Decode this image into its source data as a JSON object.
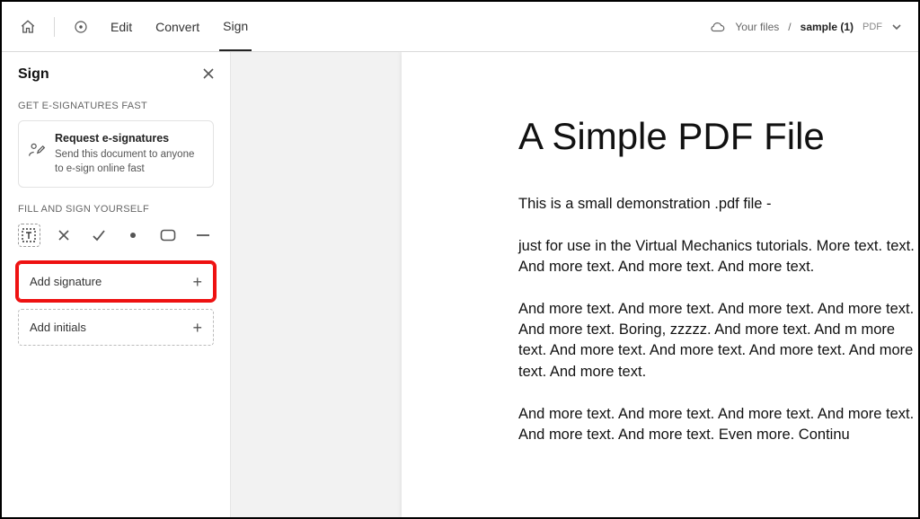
{
  "topbar": {
    "tabs": {
      "edit": "Edit",
      "convert": "Convert",
      "sign": "Sign"
    }
  },
  "breadcrumb": {
    "root": "Your files",
    "sep": "/",
    "filename": "sample (1)",
    "ext": "PDF"
  },
  "sidebar": {
    "title": "Sign",
    "section1": "GET E-SIGNATURES FAST",
    "card": {
      "title": "Request e-signatures",
      "desc": "Send this document to anyone to e-sign online fast"
    },
    "section2": "FILL AND SIGN YOURSELF",
    "add_sig": "Add signature",
    "add_ini": "Add initials"
  },
  "doc": {
    "title": "A Simple PDF File",
    "p1": "This is a small demonstration .pdf file -",
    "p2": "just for use in the Virtual Mechanics tutorials. More text. text. And more text. And more text. And more text.",
    "p3": "And more text. And more text. And more text. And more text. And more text. Boring, zzzzz. And more text. And m more text. And more text. And more text. And more text. And more text. And more text.",
    "p4": "And more text. And more text. And more text. And more text. And more text. And more text. Even more. Continu"
  }
}
